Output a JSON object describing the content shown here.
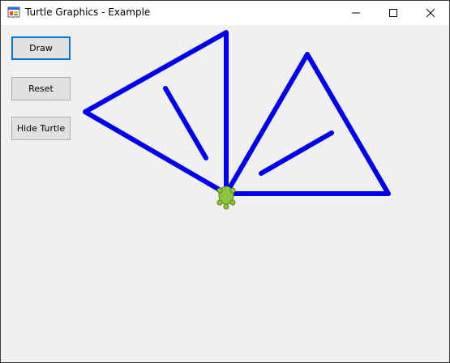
{
  "window": {
    "title": "Turtle Graphics - Example",
    "caption_buttons": [
      "minimize-icon",
      "maximize-icon",
      "close-icon"
    ]
  },
  "buttons": {
    "draw": "Draw",
    "reset": "Reset",
    "hide_turtle": "Hide Turtle"
  },
  "drawing": {
    "stroke_color": "#0000ee",
    "turtle_color": "#8cc63f"
  }
}
